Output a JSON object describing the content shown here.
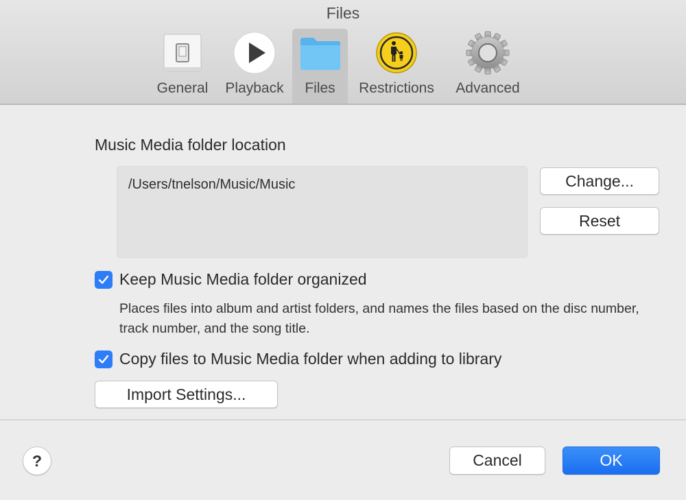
{
  "window": {
    "title": "Files"
  },
  "toolbar": {
    "tabs": [
      {
        "id": "general",
        "label": "General",
        "icon": "switch-icon",
        "active": false
      },
      {
        "id": "playback",
        "label": "Playback",
        "icon": "play-icon",
        "active": false
      },
      {
        "id": "files",
        "label": "Files",
        "icon": "folder-icon",
        "active": true
      },
      {
        "id": "restrictions",
        "label": "Restrictions",
        "icon": "parental-controls-icon",
        "active": false
      },
      {
        "id": "advanced",
        "label": "Advanced",
        "icon": "gear-icon",
        "active": false
      }
    ]
  },
  "media_folder": {
    "label": "Music Media folder location",
    "path": "/Users/tnelson/Music/Music",
    "change_button": "Change...",
    "reset_button": "Reset"
  },
  "options": {
    "keep_organized": {
      "label": "Keep Music Media folder organized",
      "checked": true,
      "description": "Places files into album and artist folders, and names the files based on the disc number, track number, and the song title."
    },
    "copy_files": {
      "label": "Copy files to Music Media folder when adding to library",
      "checked": true
    },
    "import_settings_button": "Import Settings..."
  },
  "footer": {
    "help_label": "?",
    "cancel_button": "Cancel",
    "ok_button": "OK"
  },
  "colors": {
    "accent": "#2f7df6",
    "folder_blue": "#6cc2f5",
    "restrictions_yellow": "#f5cf1c"
  }
}
